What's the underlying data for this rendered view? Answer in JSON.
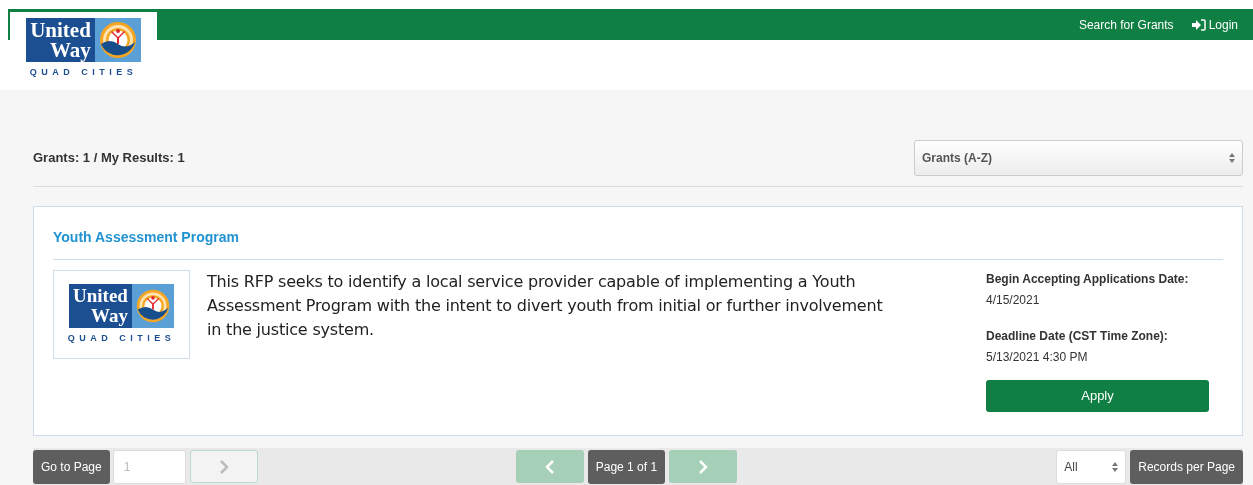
{
  "header": {
    "logo": {
      "line1": "United",
      "line2": "Way",
      "tagline": "QUAD CITIES"
    },
    "nav": [
      {
        "kind": "link",
        "label": "Search for Grants"
      },
      {
        "kind": "login",
        "label": "Login"
      }
    ]
  },
  "results": {
    "summary": "Grants: 1 / My Results: 1",
    "sort": "Grants (A-Z)"
  },
  "grants": [
    {
      "title": "Youth Assessment Program",
      "logo": {
        "line1": "United",
        "line2": "Way",
        "tagline": "QUAD CITIES"
      },
      "description": "This RFP seeks to identify a local service provider capable of implementing a Youth Assessment Program with the intent to divert youth from initial or further involvement in the justice system.",
      "begin_label": "Begin Accepting Applications Date:",
      "begin_value": "4/15/2021",
      "deadline_label": "Deadline Date (CST Time Zone):",
      "deadline_value": "5/13/2021 4:30 PM",
      "button": "Apply"
    }
  ],
  "pagination": {
    "go_to_page": "Go to Page",
    "page_input_placeholder": "1",
    "go_disabled": true,
    "prev_disabled": true,
    "page_label": "Page 1 of 1",
    "next_disabled": true,
    "records_value": "All",
    "records_button": "Records per Page"
  }
}
